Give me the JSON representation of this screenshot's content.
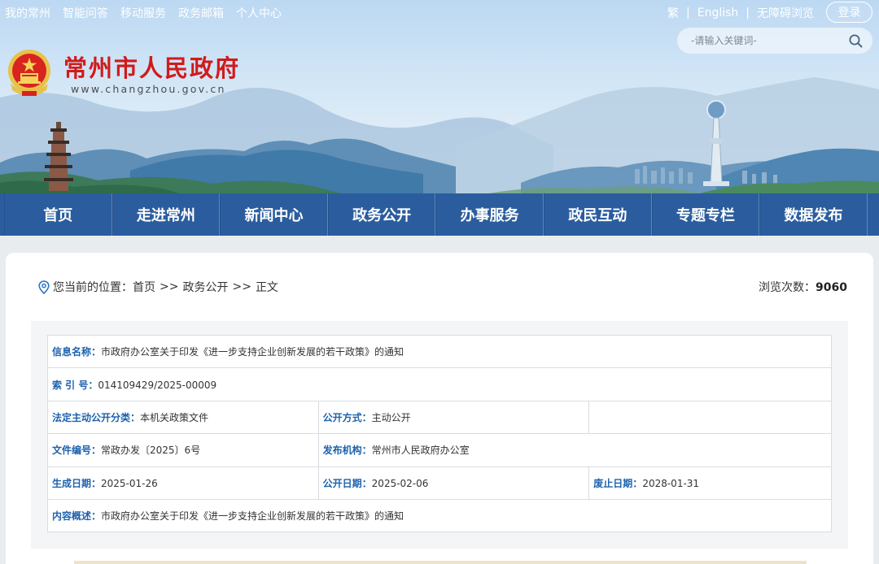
{
  "top_links": [
    "我的常州",
    "智能问答",
    "移动服务",
    "政务邮箱",
    "个人中心"
  ],
  "right_links": {
    "traditional": "繁",
    "english": "English",
    "accessibility": "无障碍浏览",
    "separator": "|",
    "login": "登录"
  },
  "search": {
    "placeholder": "-请输入关键词-"
  },
  "site": {
    "name": "常州市人民政府",
    "url": "www.changzhou.gov.cn"
  },
  "nav": [
    "首页",
    "走进常州",
    "新闻中心",
    "政务公开",
    "办事服务",
    "政民互动",
    "专题专栏",
    "数据发布"
  ],
  "breadcrumb": {
    "prefix": "您当前的位置：",
    "items": [
      "首页",
      "政务公开",
      "正文"
    ],
    "sep": ">>"
  },
  "views": {
    "label": "浏览次数：",
    "count": "9060"
  },
  "meta": {
    "info_name_label": "信息名称：",
    "info_name": "市政府办公室关于印发《进一步支持企业创新发展的若干政策》的通知",
    "index_label": "索 引 号：",
    "index": "014109429/2025-00009",
    "category_label": "法定主动公开分类：",
    "category": "本机关政策文件",
    "publish_method_label": "公开方式：",
    "publish_method": "主动公开",
    "doc_no_label": "文件编号：",
    "doc_no": "常政办发〔2025〕6号",
    "issuer_label": "发布机构：",
    "issuer": "常州市人民政府办公室",
    "created_label": "生成日期：",
    "created": "2025-01-26",
    "public_date_label": "公开日期：",
    "public_date": "2025-02-06",
    "expire_label": "废止日期：",
    "expire": "2028-01-31",
    "summary_label": "内容概述：",
    "summary": "市政府办公室关于印发《进一步支持企业创新发展的若干政策》的通知"
  },
  "colors": {
    "nav_bg": "#2b5d9e",
    "site_name": "#d21a1a",
    "meta_label": "#1d62ad"
  },
  "icons": [
    "search-icon",
    "location-pin-icon",
    "national-emblem"
  ]
}
